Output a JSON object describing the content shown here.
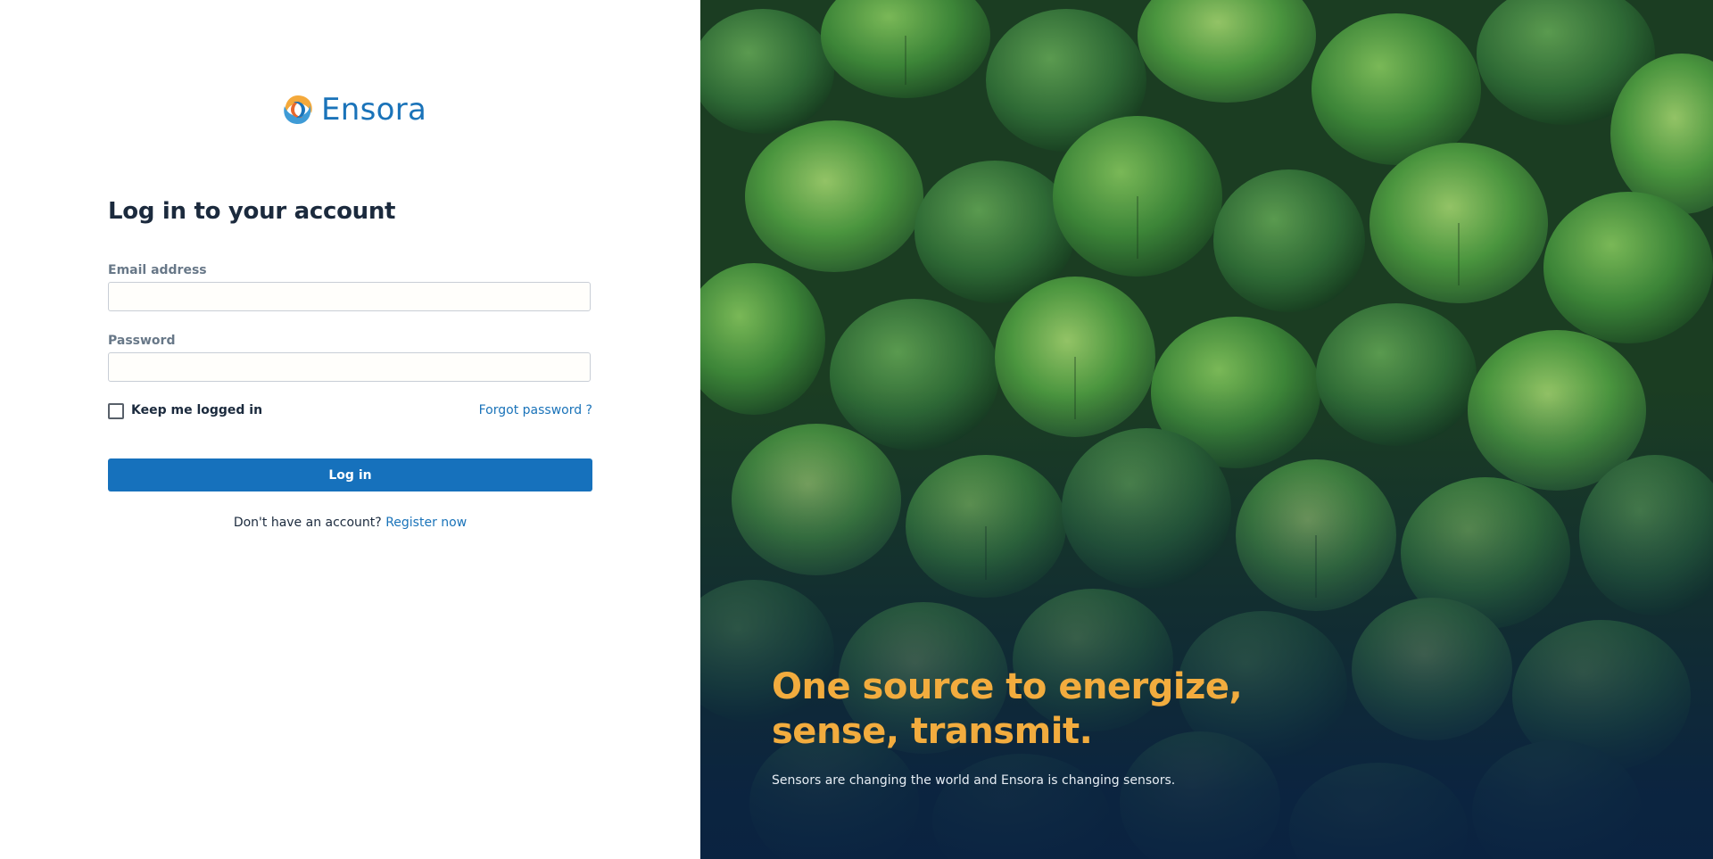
{
  "brand": {
    "name": "Ensora",
    "primary_color": "#1671bc",
    "accent_color": "#f2ac3e",
    "logo_icon": "swirl-logo-icon"
  },
  "login": {
    "title": "Log in to your account",
    "email_label": "Email address",
    "email_value": "",
    "password_label": "Password",
    "password_value": "",
    "remember_label": "Keep me logged in",
    "remember_checked": false,
    "forgot_label": "Forgot password ?",
    "submit_label": "Log in",
    "register_prompt": "Don't have an account?",
    "register_label": "Register now"
  },
  "hero": {
    "headline": "One source to energize, sense, transmit.",
    "subtitle": "Sensors are changing the world and Ensora is changing sensors.",
    "background": "green-leaves-photo"
  }
}
